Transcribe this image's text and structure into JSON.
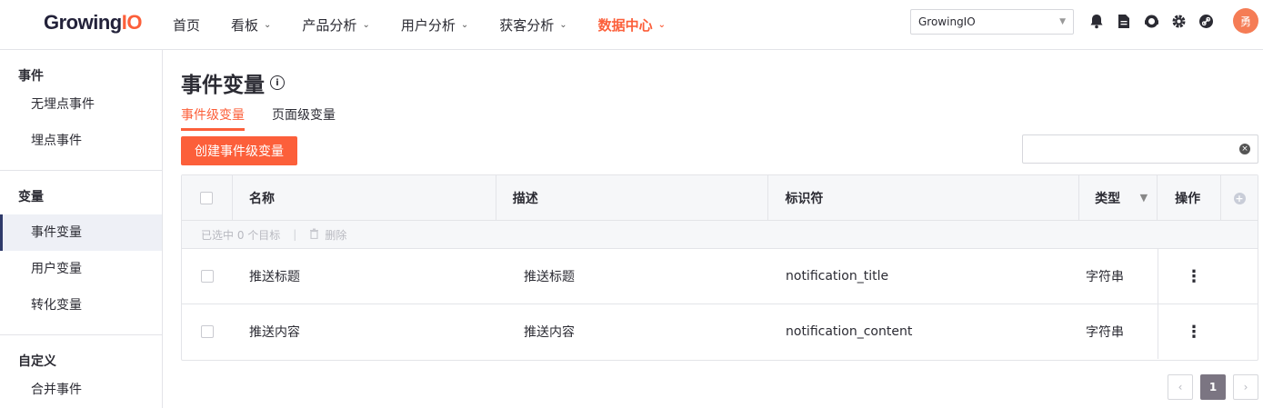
{
  "brand": {
    "logo_main": "Growing",
    "logo_io": "IO"
  },
  "nav": {
    "items": [
      {
        "label": "首页",
        "has_dropdown": false
      },
      {
        "label": "看板",
        "has_dropdown": true
      },
      {
        "label": "产品分析",
        "has_dropdown": true
      },
      {
        "label": "用户分析",
        "has_dropdown": true
      },
      {
        "label": "获客分析",
        "has_dropdown": true
      },
      {
        "label": "数据中心",
        "has_dropdown": true,
        "active": true
      }
    ]
  },
  "project_select": {
    "value": "GrowingIO"
  },
  "user": {
    "avatar_text": "勇"
  },
  "sidebar": {
    "groups": [
      {
        "title": "事件",
        "items": [
          "无埋点事件",
          "埋点事件"
        ]
      },
      {
        "title": "变量",
        "items": [
          "事件变量",
          "用户变量",
          "转化变量"
        ]
      },
      {
        "title": "自定义",
        "items": [
          "合并事件"
        ]
      }
    ],
    "active_item": "事件变量"
  },
  "page": {
    "title": "事件变量"
  },
  "tabs": [
    {
      "label": "事件级变量",
      "active": true
    },
    {
      "label": "页面级变量",
      "active": false
    }
  ],
  "toolbar": {
    "create_label": "创建事件级变量",
    "search_value": "",
    "search_placeholder": ""
  },
  "table": {
    "columns": [
      "名称",
      "描述",
      "标识符",
      "类型",
      "操作"
    ],
    "selection": {
      "text": "已选中 0 个目标",
      "delete_label": "删除"
    },
    "rows": [
      {
        "name": "推送标题",
        "description": "推送标题",
        "identifier": "notification_title",
        "type": "字符串"
      },
      {
        "name": "推送内容",
        "description": "推送内容",
        "identifier": "notification_content",
        "type": "字符串"
      }
    ]
  },
  "pagination": {
    "current": "1",
    "prev": "‹",
    "next": "›"
  },
  "colors": {
    "accent": "#fc5f3a",
    "active_page": "#7b7582",
    "sidebar_active": "#2e3a6a"
  }
}
